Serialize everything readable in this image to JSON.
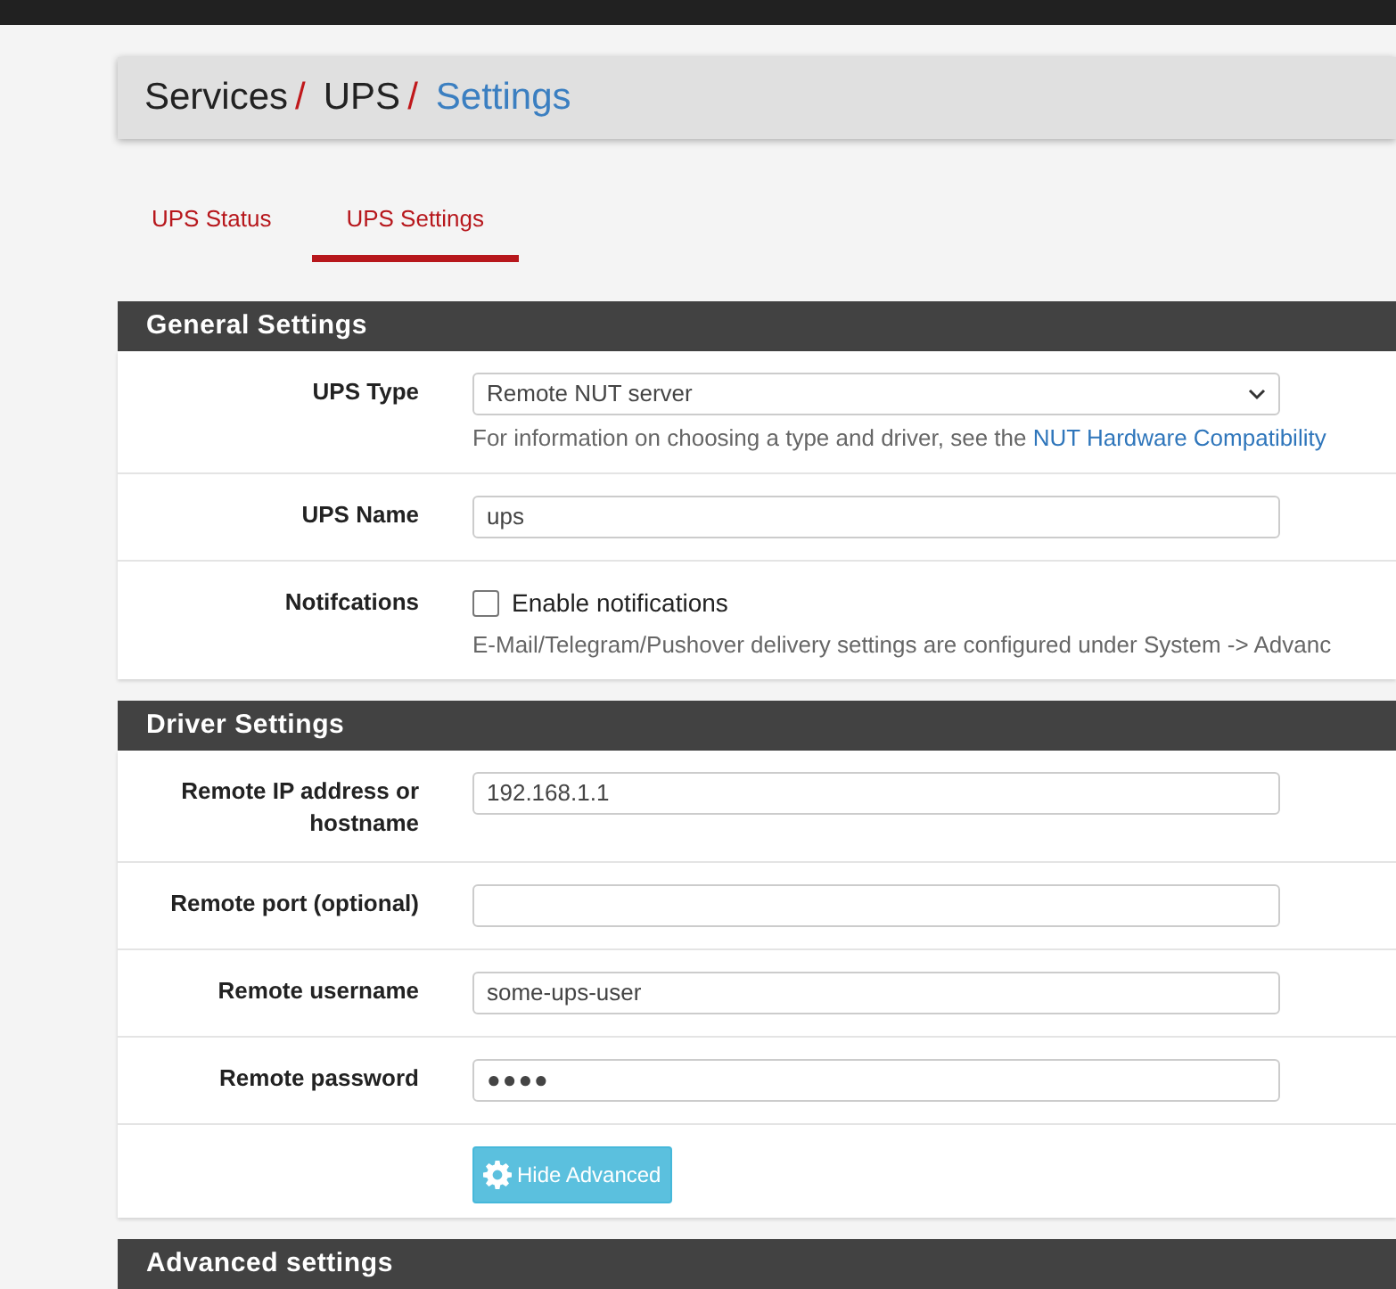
{
  "breadcrumb": [
    {
      "label": "Services",
      "current": false
    },
    {
      "label": "UPS",
      "current": false
    },
    {
      "label": "Settings",
      "current": true
    }
  ],
  "separator": "/",
  "tabs": [
    {
      "label": "UPS Status",
      "selected": false
    },
    {
      "label": "UPS Settings",
      "selected": true
    }
  ],
  "sections": [
    {
      "title": "General Settings",
      "rows": [
        {
          "kind": "select",
          "label": "UPS Type",
          "value": "Remote NUT server",
          "help": "For information on choosing a type and driver, see the ",
          "help_link": "NUT Hardware Compatibility"
        },
        {
          "kind": "text",
          "label": "UPS Name",
          "value": "ups"
        },
        {
          "kind": "checkbox",
          "label": "Notifcations",
          "option": "Enable notifications",
          "checked": false,
          "help": "E-Mail/Telegram/Pushover delivery settings are configured under System -> Advanc"
        }
      ]
    },
    {
      "title": "Driver Settings",
      "rows": [
        {
          "kind": "text",
          "label": "Remote IP address or hostname",
          "value": "192.168.1.1"
        },
        {
          "kind": "text",
          "label": "Remote port (optional)"
        },
        {
          "kind": "text",
          "label": "Remote username",
          "value": "some-ups-user"
        },
        {
          "kind": "password",
          "label": "Remote password",
          "value": "●●●●"
        },
        {
          "kind": "button",
          "button": "Hide Advanced"
        }
      ]
    },
    {
      "title": "Advanced settings"
    }
  ]
}
